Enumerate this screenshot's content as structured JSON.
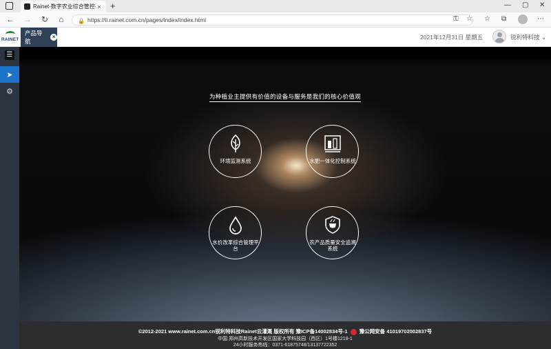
{
  "browser": {
    "tab_title": "Rainet-数字农业综合管控平台",
    "tab_close": "×",
    "new_tab": "+",
    "url": "https://ii.rainet.com.cn/pages/index/index.html",
    "window_controls": [
      "—",
      "▢",
      "✕"
    ]
  },
  "header": {
    "logo_text": "RAINET",
    "product_tab": "产品导航",
    "product_tab_close": "×",
    "date": "2021年12月31日 星期五",
    "user_name": "锐利特科技"
  },
  "sidebar": {
    "items": [
      {
        "icon": "menu-icon",
        "glyph": "☰"
      },
      {
        "icon": "send-icon",
        "glyph": "➤"
      },
      {
        "icon": "gear-icon",
        "glyph": "⚙"
      }
    ]
  },
  "main": {
    "headline": "为种植业主提供有价值的设备与服务是我们的核心价值观",
    "systems": [
      {
        "label": "环境监测系统",
        "icon": "leaf-icon"
      },
      {
        "label": "水肥一体化控制系统",
        "icon": "irrigation-icon"
      },
      {
        "label": "水价改革综合管理平台",
        "icon": "water-drop-icon"
      },
      {
        "label": "农产品质量安全追溯系统",
        "icon": "shield-cup-icon"
      }
    ]
  },
  "footer": {
    "line1_left": "©2012-2021 www.rainet.com.cn锐利特科技Rainet云灌溉 版权所有 豫ICP备14002834号-1",
    "line1_right": "豫公网安备 41019702002837号",
    "line2": "中国.郑州高新技术开发区国家大学科技园（西区）1号楼1218-1",
    "line3": "24小时服务热线：0371-61875748/13137722352"
  },
  "colors": {
    "sidebar_bg": "#2c3440",
    "sidebar_active": "#1b74c9",
    "product_tab_bg": "#2f4156",
    "footer_bg": "#2b2d30"
  }
}
